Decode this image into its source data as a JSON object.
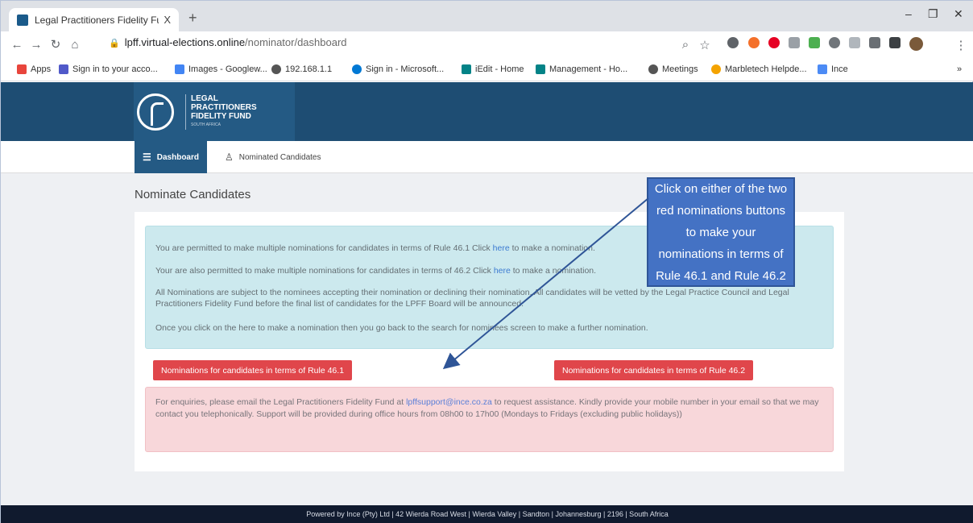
{
  "browser": {
    "tab_title": "Legal Practitioners Fidelity Fund",
    "tab_close": "X",
    "new_tab": "+",
    "url_domain": "lpff.virtual-elections.online",
    "url_path": "/nominator/dashboard",
    "window_controls": [
      "–",
      "❐",
      "✕"
    ],
    "bookmarks": [
      {
        "label": "Apps",
        "color": "#e8453c"
      },
      {
        "label": "Sign in to your acco...",
        "color": "#5059c9"
      },
      {
        "label": "Images - Googlew...",
        "color": "#4285f4"
      },
      {
        "label": "192.168.1.1",
        "color": "#555555"
      },
      {
        "label": "Sign in - Microsoft...",
        "color": "#0078d4"
      },
      {
        "label": "iEdit - Home",
        "color": "#038387"
      },
      {
        "label": "Management - Ho...",
        "color": "#038387"
      },
      {
        "label": "Meetings",
        "color": "#555555"
      },
      {
        "label": "Marbletech Helpde...",
        "color": "#f4a300"
      },
      {
        "label": "Ince",
        "color": "#4c8bf5"
      }
    ],
    "bookmarks_more": "»"
  },
  "site": {
    "logo_lines": [
      "LEGAL",
      "PRACTITIONERS",
      "FIDELITY FUND"
    ],
    "logo_sub": "SOUTH AFRICA",
    "nav": {
      "dashboard": "Dashboard",
      "nominated": "Nominated Candidates"
    },
    "page_title": "Nominate Candidates",
    "info": {
      "p1_before": "You are permitted to make multiple nominations for candidates in terms of Rule 46.1 Click ",
      "p1_link": "here",
      "p1_after": " to make a nomination.",
      "p2_before": "Your are also permitted to make multiple nominations for candidates in terms of 46.2 Click ",
      "p2_link": "here",
      "p2_after": " to make a nomination.",
      "p3": "All Nominations are subject to the nominees accepting their nomination or declining their nomination. All candidates will be vetted by the Legal Practice Council and Legal Practitioners Fidelity Fund before the final list of candidates for the LPFF Board will be announced.",
      "p4": "Once you click on the here to make a nomination then you go back to the search for nominees screen to make a further nomination."
    },
    "btn_461": "Nominations for candidates in terms of Rule 46.1",
    "btn_462": "Nominations for candidates in terms of Rule 46.2",
    "support": {
      "before": "For enquiries, please email the Legal Practitioners Fidelity Fund at ",
      "email": "lpffsupport@ince.co.za",
      "after": " to request assistance. Kindly provide your mobile number in your email so that we may contact you telephonically. Support will be provided during office hours from 08h00 to 17h00 (Mondays to Fridays (excluding public holidays))"
    },
    "footer": "Powered by Ince (Pty) Ltd | 42 Wierda Road West | Wierda Valley | Sandton | Johannesburg | 2196 | South Africa"
  },
  "callout_text": "Click on either of the two red nominations buttons to make your nominations in terms of Rule 46.1 and Rule 46.2"
}
